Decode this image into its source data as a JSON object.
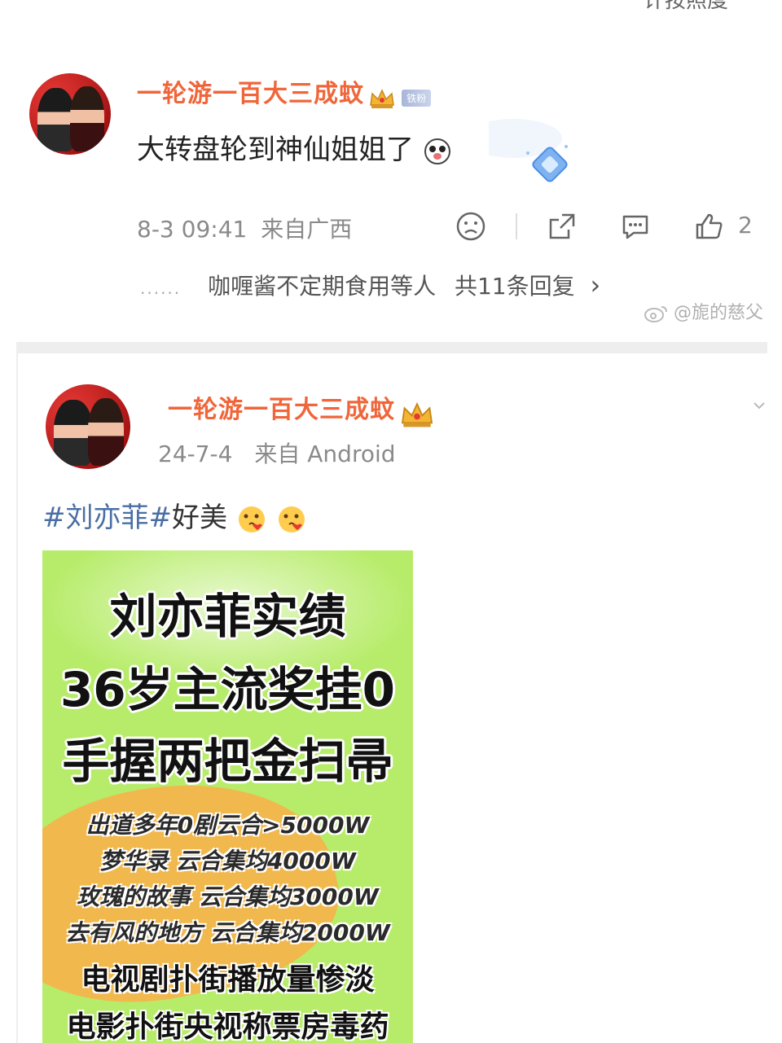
{
  "top_cut_text": "计按照度",
  "comment": {
    "username": "一轮游一百大三成蚊",
    "fan_badge": "铁粉",
    "text": "大转盘轮到神仙姐姐了",
    "time": "8-3 09:41",
    "source": "来自广西",
    "like_count": "2",
    "dots": "......",
    "replies_text": "咖喱酱不定期食用等人",
    "replies_count": "共11条回复",
    "replies_chevron": "›"
  },
  "watermark": "@旎的慈父",
  "post": {
    "username": "一轮游一百大三成蚊",
    "date": "24-7-4",
    "source": "来自 Android",
    "hashtag": "#刘亦菲#",
    "text": "好美",
    "poster": {
      "line1": "刘亦菲实绩",
      "line2": "36岁主流奖挂0",
      "line3": "手握两把金扫帚",
      "line4": "出道多年0剧云合>5000W",
      "line5": "梦华录 云合集均4000W",
      "line6": "玫瑰的故事 云合集均3000W",
      "line7": "去有风的地方 云合集均2000W",
      "line8": "电视剧扑街播放量惨淡",
      "line9": "电影扑街央视称票房毒药"
    }
  },
  "colors": {
    "username": "#f0663a",
    "hashtag": "#4a6fa5",
    "poster_bg": "#b7ec6a",
    "poster_orange": "#f7b34a"
  }
}
